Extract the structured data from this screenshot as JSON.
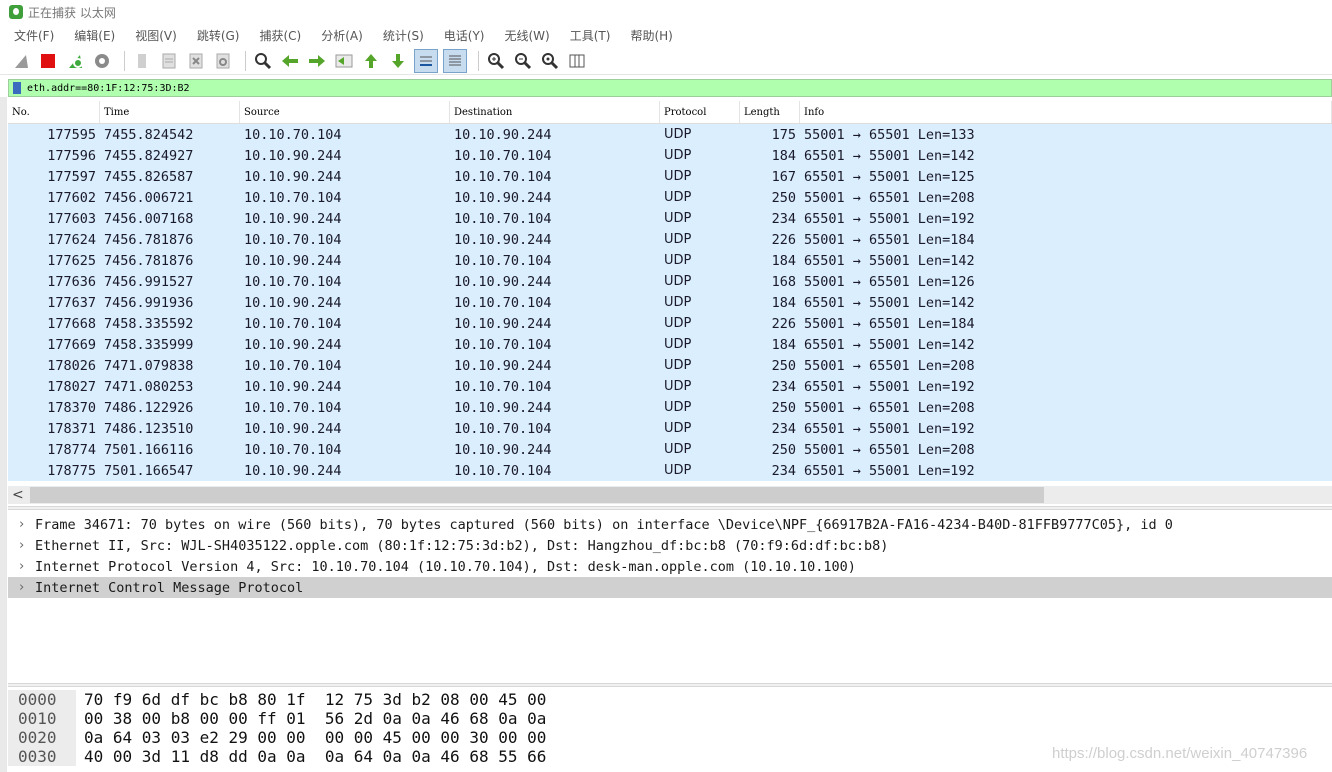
{
  "window": {
    "title": "正在捕获 以太网"
  },
  "menu": [
    "文件(F)",
    "编辑(E)",
    "视图(V)",
    "跳转(G)",
    "捕获(C)",
    "分析(A)",
    "统计(S)",
    "电话(Y)",
    "无线(W)",
    "工具(T)",
    "帮助(H)"
  ],
  "toolbar": {
    "icons": [
      "shark-fin-start-icon",
      "stop-capture-icon",
      "restart-capture-icon",
      "capture-options-icon",
      "open-file-icon",
      "save-file-icon",
      "close-file-icon",
      "reload-file-icon",
      "find-packet-icon",
      "go-back-icon",
      "go-forward-icon",
      "go-to-packet-icon",
      "first-packet-icon",
      "last-packet-icon",
      "autoscroll-icon",
      "colorize-icon",
      "zoom-in-icon",
      "zoom-out-icon",
      "normal-size-icon",
      "resize-columns-icon"
    ]
  },
  "filter": {
    "value": "eth.addr==80:1F:12:75:3D:B2"
  },
  "packet_list": {
    "columns": [
      "No.",
      "Time",
      "Source",
      "Destination",
      "Protocol",
      "Length",
      "Info"
    ],
    "rows": [
      [
        "177595",
        "7455.824542",
        "10.10.70.104",
        "10.10.90.244",
        "UDP",
        "175",
        "55001 → 65501 Len=133"
      ],
      [
        "177596",
        "7455.824927",
        "10.10.90.244",
        "10.10.70.104",
        "UDP",
        "184",
        "65501 → 55001 Len=142"
      ],
      [
        "177597",
        "7455.826587",
        "10.10.90.244",
        "10.10.70.104",
        "UDP",
        "167",
        "65501 → 55001 Len=125"
      ],
      [
        "177602",
        "7456.006721",
        "10.10.70.104",
        "10.10.90.244",
        "UDP",
        "250",
        "55001 → 65501 Len=208"
      ],
      [
        "177603",
        "7456.007168",
        "10.10.90.244",
        "10.10.70.104",
        "UDP",
        "234",
        "65501 → 55001 Len=192"
      ],
      [
        "177624",
        "7456.781876",
        "10.10.70.104",
        "10.10.90.244",
        "UDP",
        "226",
        "55001 → 65501 Len=184"
      ],
      [
        "177625",
        "7456.781876",
        "10.10.90.244",
        "10.10.70.104",
        "UDP",
        "184",
        "65501 → 55001 Len=142"
      ],
      [
        "177636",
        "7456.991527",
        "10.10.70.104",
        "10.10.90.244",
        "UDP",
        "168",
        "55001 → 65501 Len=126"
      ],
      [
        "177637",
        "7456.991936",
        "10.10.90.244",
        "10.10.70.104",
        "UDP",
        "184",
        "65501 → 55001 Len=142"
      ],
      [
        "177668",
        "7458.335592",
        "10.10.70.104",
        "10.10.90.244",
        "UDP",
        "226",
        "55001 → 65501 Len=184"
      ],
      [
        "177669",
        "7458.335999",
        "10.10.90.244",
        "10.10.70.104",
        "UDP",
        "184",
        "65501 → 55001 Len=142"
      ],
      [
        "178026",
        "7471.079838",
        "10.10.70.104",
        "10.10.90.244",
        "UDP",
        "250",
        "55001 → 65501 Len=208"
      ],
      [
        "178027",
        "7471.080253",
        "10.10.90.244",
        "10.10.70.104",
        "UDP",
        "234",
        "65501 → 55001 Len=192"
      ],
      [
        "178370",
        "7486.122926",
        "10.10.70.104",
        "10.10.90.244",
        "UDP",
        "250",
        "55001 → 65501 Len=208"
      ],
      [
        "178371",
        "7486.123510",
        "10.10.90.244",
        "10.10.70.104",
        "UDP",
        "234",
        "65501 → 55001 Len=192"
      ],
      [
        "178774",
        "7501.166116",
        "10.10.70.104",
        "10.10.90.244",
        "UDP",
        "250",
        "55001 → 65501 Len=208"
      ],
      [
        "178775",
        "7501.166547",
        "10.10.90.244",
        "10.10.70.104",
        "UDP",
        "234",
        "65501 → 55001 Len=192"
      ]
    ]
  },
  "details": [
    "Frame 34671: 70 bytes on wire (560 bits), 70 bytes captured (560 bits) on interface \\Device\\NPF_{66917B2A-FA16-4234-B40D-81FFB9777C05}, id 0",
    "Ethernet II, Src: WJL-SH4035122.opple.com (80:1f:12:75:3d:b2), Dst: Hangzhou_df:bc:b8 (70:f9:6d:df:bc:b8)",
    "Internet Protocol Version 4, Src: 10.10.70.104 (10.10.70.104), Dst: desk-man.opple.com (10.10.10.100)",
    "Internet Control Message Protocol"
  ],
  "hex": [
    {
      "offset": "0000",
      "bytes": "70 f9 6d df bc b8 80 1f  12 75 3d b2 08 00 45 00"
    },
    {
      "offset": "0010",
      "bytes": "00 38 00 b8 00 00 ff 01  56 2d 0a 0a 46 68 0a 0a"
    },
    {
      "offset": "0020",
      "bytes": "0a 64 03 03 e2 29 00 00  00 00 45 00 00 30 00 00"
    },
    {
      "offset": "0030",
      "bytes": "40 00 3d 11 d8 dd 0a 0a  0a 64 0a 0a 46 68 55 66"
    }
  ],
  "watermark": "https://blog.csdn.net/weixin_40747396",
  "colors": {
    "row_bg": "#daeefe",
    "filter_bg": "#afffaf",
    "selected_detail": "#d0d0d0"
  }
}
